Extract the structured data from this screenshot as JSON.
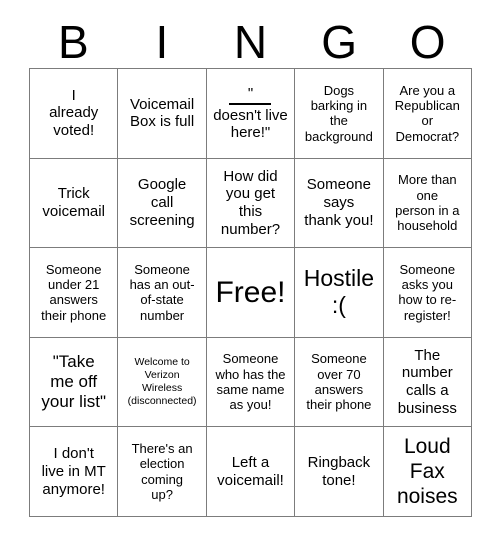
{
  "card": {
    "header_letters": [
      "B",
      "I",
      "N",
      "G",
      "O"
    ],
    "rows": [
      [
        {
          "text": "I\nalready\nvoted!",
          "size": "normal"
        },
        {
          "text": "Voicemail\nBox is full",
          "size": "normal"
        },
        {
          "text_before_blank": "\"",
          "blank": "______",
          "text_after_blank": "doesn't\nlive here!\"",
          "size": "normal",
          "style": "blank-line"
        },
        {
          "text": "Dogs\nbarking in\nthe\nbackground",
          "size": "small"
        },
        {
          "text": "Are you a\nRepublican\nor\nDemocrat?",
          "size": "small"
        }
      ],
      [
        {
          "text": "Trick\nvoicemail",
          "size": "normal"
        },
        {
          "text": "Google\ncall\nscreening",
          "size": "normal"
        },
        {
          "text": "How did\nyou get\nthis\nnumber?",
          "size": "normal"
        },
        {
          "text": "Someone\nsays\nthank you!",
          "size": "normal"
        },
        {
          "text": "More than\none\nperson in a\nhousehold",
          "size": "small"
        }
      ],
      [
        {
          "text": "Someone\nunder 21\nanswers\ntheir phone",
          "size": "small"
        },
        {
          "text": "Someone\nhas an out-\nof-state\nnumber",
          "size": "small"
        },
        {
          "text": "Free!",
          "size": "free",
          "free_space": true
        },
        {
          "text": "Hostile\n:(",
          "size": "xlarge"
        },
        {
          "text": "Someone\nasks you\nhow to re-\nregister!",
          "size": "small"
        }
      ],
      [
        {
          "text": "\"Take\nme off\nyour list\"",
          "size": "medium"
        },
        {
          "text": "Welcome to\nVerizon\nWireless\n(disconnected)",
          "size": "tiny"
        },
        {
          "text": "Someone\nwho has the\nsame name\nas you!",
          "size": "small"
        },
        {
          "text": "Someone\nover 70\nanswers\ntheir phone",
          "size": "small"
        },
        {
          "text": "The\nnumber\ncalls a\nbusiness",
          "size": "normal"
        }
      ],
      [
        {
          "text": "I don't\nlive in MT\nanymore!",
          "size": "normal"
        },
        {
          "text": "There's an\nelection\ncoming\nup?",
          "size": "small"
        },
        {
          "text": "Left a\nvoicemail!",
          "size": "normal"
        },
        {
          "text": "Ringback\ntone!",
          "size": "normal"
        },
        {
          "text": "Loud\nFax\nnoises",
          "size": "large"
        }
      ]
    ]
  },
  "colors": {
    "background": "#ffffff",
    "text": "#000000",
    "grid_line": "#7c7c7c"
  }
}
